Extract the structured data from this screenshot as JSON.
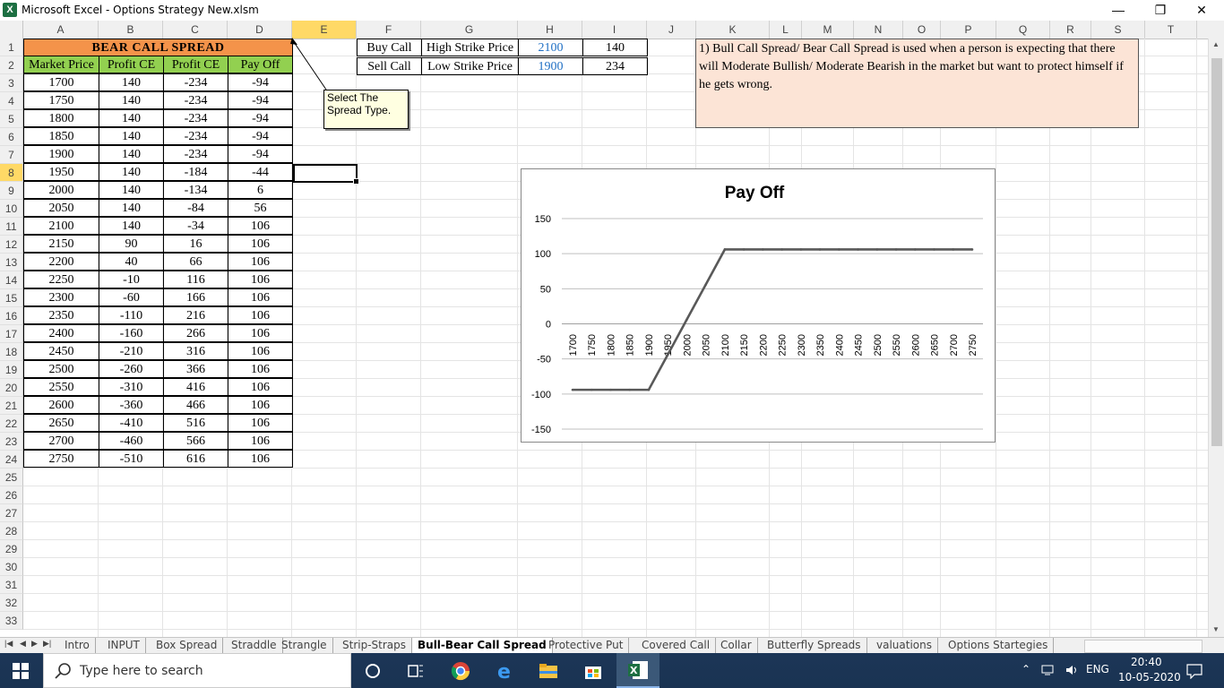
{
  "window": {
    "title": "Microsoft Excel - Options Strategy New.xlsm",
    "logo_letter": "X",
    "minimize": "—",
    "restore": "❐",
    "close": "✕"
  },
  "columns": [
    "A",
    "B",
    "C",
    "D",
    "E",
    "F",
    "G",
    "H",
    "I",
    "J",
    "K",
    "L",
    "M",
    "N",
    "O",
    "P",
    "Q",
    "R",
    "S",
    "T"
  ],
  "rows": [
    "1",
    "2",
    "3",
    "4",
    "5",
    "6",
    "7",
    "8",
    "9",
    "10",
    "11",
    "12",
    "13",
    "14",
    "15",
    "16",
    "17",
    "18",
    "19",
    "20",
    "21",
    "22",
    "23",
    "24",
    "25",
    "26",
    "27",
    "28",
    "29",
    "30",
    "31",
    "32",
    "33"
  ],
  "sheet": {
    "banner": "BEAR CALL SPREAD",
    "headers": [
      "Market Price",
      "Profit CE",
      "Profit CE",
      "Pay Off"
    ],
    "table": [
      [
        "1700",
        "140",
        "-234",
        "-94"
      ],
      [
        "1750",
        "140",
        "-234",
        "-94"
      ],
      [
        "1800",
        "140",
        "-234",
        "-94"
      ],
      [
        "1850",
        "140",
        "-234",
        "-94"
      ],
      [
        "1900",
        "140",
        "-234",
        "-94"
      ],
      [
        "1950",
        "140",
        "-184",
        "-44"
      ],
      [
        "2000",
        "140",
        "-134",
        "6"
      ],
      [
        "2050",
        "140",
        "-84",
        "56"
      ],
      [
        "2100",
        "140",
        "-34",
        "106"
      ],
      [
        "2150",
        "90",
        "16",
        "106"
      ],
      [
        "2200",
        "40",
        "66",
        "106"
      ],
      [
        "2250",
        "-10",
        "116",
        "106"
      ],
      [
        "2300",
        "-60",
        "166",
        "106"
      ],
      [
        "2350",
        "-110",
        "216",
        "106"
      ],
      [
        "2400",
        "-160",
        "266",
        "106"
      ],
      [
        "2450",
        "-210",
        "316",
        "106"
      ],
      [
        "2500",
        "-260",
        "366",
        "106"
      ],
      [
        "2550",
        "-310",
        "416",
        "106"
      ],
      [
        "2600",
        "-360",
        "466",
        "106"
      ],
      [
        "2650",
        "-410",
        "516",
        "106"
      ],
      [
        "2700",
        "-460",
        "566",
        "106"
      ],
      [
        "2750",
        "-510",
        "616",
        "106"
      ]
    ],
    "strike_table": [
      {
        "action": "Buy Call",
        "label": "High Strike Price",
        "strike": "2100",
        "premium": "140"
      },
      {
        "action": "Sell Call",
        "label": "Low Strike Price",
        "strike": "1900",
        "premium": "234"
      }
    ],
    "note": "Select The Spread Type.",
    "info": "1) Bull Call Spread/ Bear Call Spread is used when a person is expecting that there will Moderate Bullish/ Moderate Bearish in the market but want to protect himself if he gets wrong."
  },
  "chart_data": {
    "type": "line",
    "title": "Pay Off",
    "x": [
      1700,
      1750,
      1800,
      1850,
      1900,
      1950,
      2000,
      2050,
      2100,
      2150,
      2200,
      2250,
      2300,
      2350,
      2400,
      2450,
      2500,
      2550,
      2600,
      2650,
      2700,
      2750
    ],
    "series": [
      {
        "values": [
          -94,
          -94,
          -94,
          -94,
          -94,
          -44,
          6,
          56,
          106,
          106,
          106,
          106,
          106,
          106,
          106,
          106,
          106,
          106,
          106,
          106,
          106,
          106
        ]
      }
    ],
    "yticks": [
      150,
      100,
      50,
      0,
      -50,
      -100,
      -150
    ],
    "ylim": [
      -150,
      150
    ],
    "grid": true,
    "line_color": "#595959"
  },
  "tabs": [
    "Intro",
    "INPUT",
    "Box Spread",
    "Straddle",
    "Strangle",
    "Strip-Straps",
    "Bull-Bear Call Spread",
    "Protective Put",
    "Covered Call",
    "Collar",
    "Butterfly Spreads",
    "valuations",
    "Options Startegies"
  ],
  "active_tab": "Bull-Bear Call Spread",
  "taskbar": {
    "search_placeholder": "Type here to search",
    "lang": "ENG",
    "time": "20:40",
    "date": "10-05-2020"
  }
}
